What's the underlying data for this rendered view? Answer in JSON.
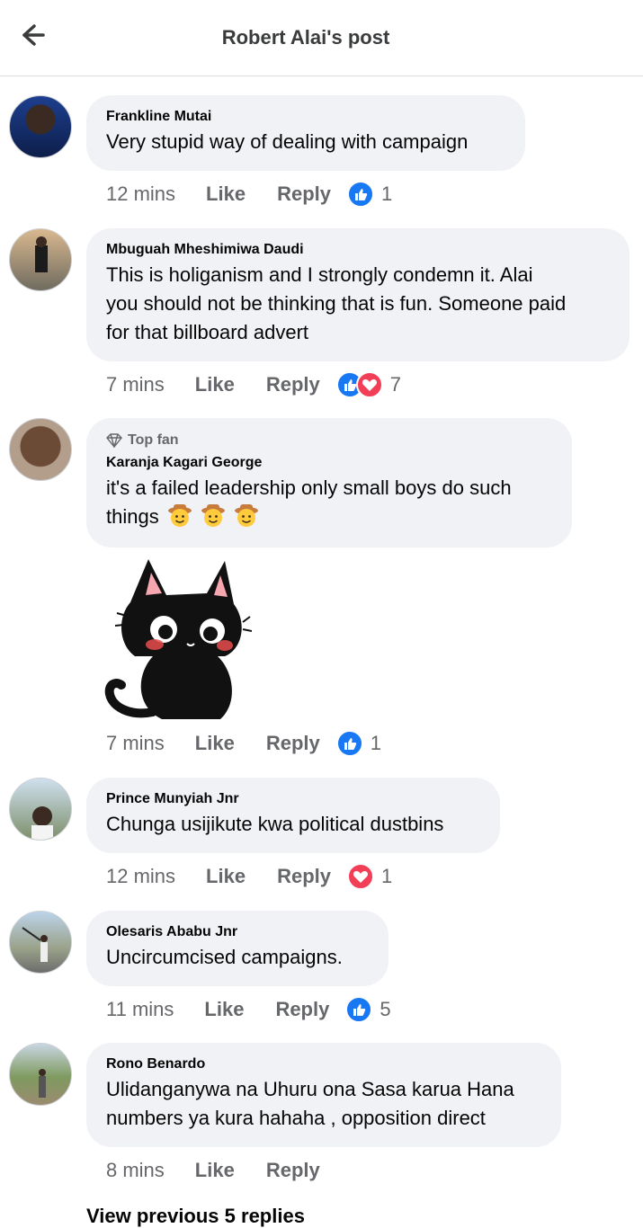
{
  "header": {
    "title": "Robert Alai's post",
    "back_icon": "arrow-left-icon"
  },
  "labels": {
    "like": "Like",
    "reply": "Reply"
  },
  "comments": [
    {
      "author": "Frankline Mutai",
      "lines": [
        "Very stupid way of dealing with campaign"
      ],
      "time": "12 mins",
      "reactions": [
        "like"
      ],
      "count": "1"
    },
    {
      "author": "Mbuguah Mheshimiwa Daudi",
      "lines": [
        "This is holiganism and I strongly condemn it. Alai",
        "you should not be thinking that is fun. Someone paid",
        "for that billboard advert"
      ],
      "time": "7 mins",
      "reactions": [
        "like",
        "love"
      ],
      "count": "7"
    },
    {
      "badge": "Top fan",
      "author": "Karanja Kagari George",
      "lines": [
        "it's a failed leadership only small boys do such",
        "things"
      ],
      "emoji": "cowboy-face-emoji",
      "time": "7 mins",
      "reactions": [
        "like"
      ],
      "count": "1",
      "sticker": "black-cat-sticker"
    },
    {
      "author": "Prince Munyiah Jnr",
      "lines": [
        "Chunga usijikute kwa political dustbins"
      ],
      "time": "12 mins",
      "reactions": [
        "love"
      ],
      "count": "1"
    },
    {
      "author": "Olesaris Ababu Jnr",
      "lines": [
        "Uncircumcised campaigns."
      ],
      "time": "11 mins",
      "reactions": [
        "like"
      ],
      "count": "5"
    },
    {
      "author": "Rono Benardo",
      "lines": [
        "Ulidanganywa na Uhuru ona Sasa karua Hana",
        "numbers ya kura hahaha , opposition direct"
      ],
      "time": "8 mins",
      "reactions": [],
      "count": ""
    }
  ],
  "view_previous": "View previous 5 replies",
  "colors": {
    "like": "#1877f2",
    "love": "#f33e58",
    "bubble": "#f0f2f5",
    "meta": "#65676b"
  }
}
